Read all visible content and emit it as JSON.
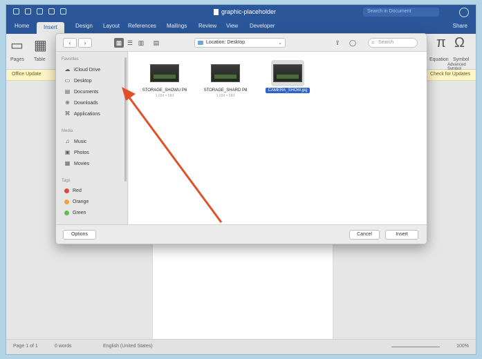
{
  "window": {
    "document_title": "graphic-placeholder",
    "search_placeholder": "Search in Document",
    "tabs": [
      "Home",
      "Insert",
      "Design",
      "Layout",
      "References",
      "Mailings",
      "Review",
      "View",
      "Developer"
    ],
    "active_tab": "Insert",
    "share_label": "Share"
  },
  "ribbon": {
    "left_labels": [
      "Pages",
      "Table"
    ],
    "right_labels": [
      "Equation",
      "Symbol"
    ],
    "right_sub": "Advanced Symbol"
  },
  "infobar": {
    "left_text": "Office Update",
    "right_text": "Check for Updates"
  },
  "dialog": {
    "location": "Location: Desktop",
    "search_placeholder": "Search",
    "sidebar": {
      "favorites_header": "Favorites",
      "favorites": [
        {
          "icon": "cloud-icon",
          "label": "iCloud Drive"
        },
        {
          "icon": "desktop-icon",
          "label": "Desktop"
        },
        {
          "icon": "documents-icon",
          "label": "Documents"
        },
        {
          "icon": "downloads-icon",
          "label": "Downloads"
        },
        {
          "icon": "applications-icon",
          "label": "Applications"
        }
      ],
      "media_header": "Media",
      "media": [
        {
          "icon": "music-icon",
          "label": "Music"
        },
        {
          "icon": "photos-icon",
          "label": "Photos"
        },
        {
          "icon": "movies-icon",
          "label": "Movies"
        }
      ],
      "tags_header": "Tags",
      "tags": [
        {
          "label": "Red",
          "color": "#e0483e"
        },
        {
          "label": "Orange",
          "color": "#f1a33b"
        },
        {
          "label": "Green",
          "color": "#5cbf4a"
        }
      ]
    },
    "files": [
      {
        "name": "STORAGE_SHOWU P6",
        "meta": "1,024 × 683"
      },
      {
        "name": "STORAGE_SHARD P8",
        "meta": "1,024 × 683"
      },
      {
        "name": "CAMERA_SHOW.jpg",
        "meta": "",
        "selected": true
      }
    ],
    "options_label": "Options",
    "cancel_label": "Cancel",
    "insert_label": "Insert"
  },
  "statusbar": {
    "page": "Page 1 of 1",
    "words": "0 words",
    "language": "English (United States)",
    "zoom": "100%"
  },
  "colors": {
    "brand": "#2b579a",
    "annotation_arrow": "#e0502a",
    "selection": "#2f62c7"
  }
}
